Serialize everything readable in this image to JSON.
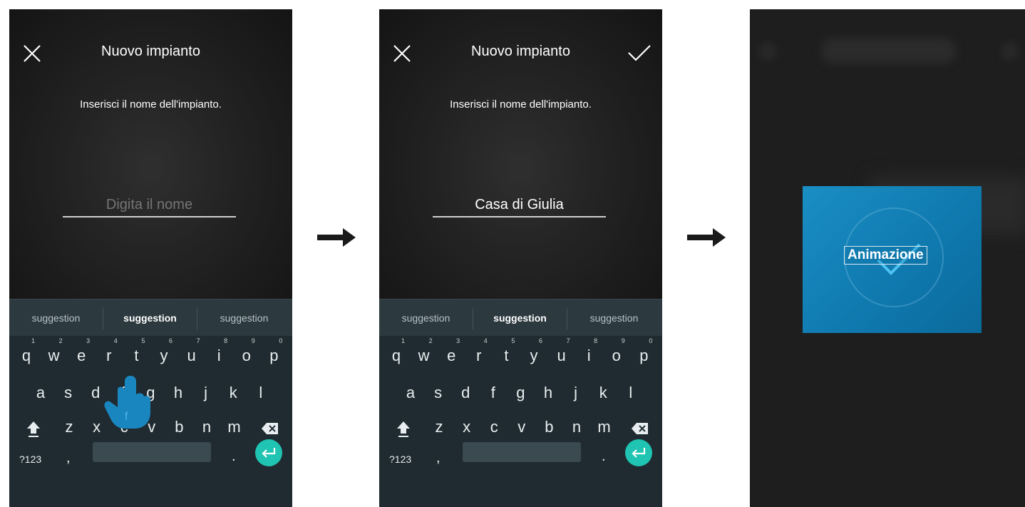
{
  "screens": [
    {
      "title": "Nuovo impianto",
      "prompt": "Inserisci il nome dell'impianto.",
      "name_placeholder": "Digita il nome",
      "name_value": "",
      "suggestions": [
        "suggestion",
        "suggestion",
        "suggestion"
      ]
    },
    {
      "title": "Nuovo impianto",
      "prompt": "Inserisci il nome dell'impianto.",
      "name_value": "Casa di Giulia",
      "suggestions": [
        "suggestion",
        "suggestion",
        "suggestion"
      ]
    },
    {
      "animation_label": "Animazione"
    }
  ],
  "keyboard": {
    "row1": [
      "q",
      "w",
      "e",
      "r",
      "t",
      "y",
      "u",
      "i",
      "o",
      "p"
    ],
    "row1_hints": [
      "1",
      "2",
      "3",
      "4",
      "5",
      "6",
      "7",
      "8",
      "9",
      "0"
    ],
    "row2": [
      "a",
      "s",
      "d",
      "f",
      "g",
      "h",
      "j",
      "k",
      "l"
    ],
    "row3": [
      "z",
      "x",
      "c",
      "v",
      "b",
      "n",
      "m"
    ],
    "symbols_label": "?123",
    "comma": ",",
    "period": "."
  },
  "icons": {
    "close": "close-icon",
    "confirm": "check-icon",
    "shift": "shift-icon",
    "backspace": "backspace-icon",
    "enter": "enter-icon",
    "tap": "tap-hand-icon",
    "arrow": "arrow-right-icon"
  },
  "colors": {
    "accent": "#20c4b2",
    "keyboard_bg": "#263238",
    "animation_card": "#1483ba",
    "hand": "#1a86c0"
  }
}
